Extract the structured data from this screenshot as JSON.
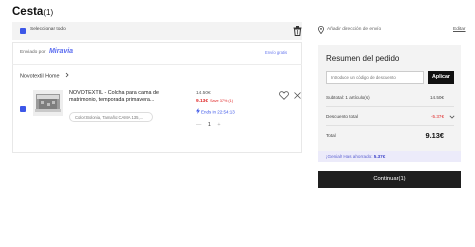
{
  "page": {
    "title": "Cesta",
    "title_count": "(1)"
  },
  "select_all": {
    "label": "Seleccionar todo"
  },
  "seller_block": {
    "sent_by": "Enviado por",
    "seller_name": "Miravia",
    "shipping": "Envío gratis",
    "store_name": "Novotextil Home"
  },
  "item": {
    "title": "NOVOTEXTIL - Colcha para cama de matrimonio, temporada primavera...",
    "variant": "Color:Bolonia, Tamaño:CAMA 135,...",
    "old_price": "14.50€",
    "new_price": "9.13€",
    "saving_tag": "Save 37% (1)",
    "ends_label": "Ends in 22:54:13",
    "quantity": "1",
    "qty_minus": "—",
    "qty_plus": "+"
  },
  "address": {
    "label": "Añadir dirección de envío",
    "edit": "Editar"
  },
  "summary": {
    "title": "Resumen del pedido",
    "coupon_placeholder": "Introduce un código de descuento",
    "apply": "Aplicar",
    "subtotal_label": "Subtotal: 1 artículo(s)",
    "subtotal_value": "14.50€",
    "discount_label": "Descuento total",
    "discount_value": "-5.37€",
    "total_label": "Total",
    "total_value": "9.13€",
    "savings_prefix": "¡Genial! Has ahorrado:",
    "savings_value": "5.37€",
    "checkout": "Continuar(1)"
  },
  "colors": {
    "accent_blue": "#3d57e8",
    "sale_red": "#e02828",
    "checkout_bg": "#1f1f1f",
    "panel_gray": "#f3f3f3"
  },
  "icons": [
    "checkbox-icon",
    "trash-icon",
    "chevron-right-icon",
    "heart-icon",
    "close-icon",
    "lightning-icon",
    "location-pin-icon",
    "chevron-down-icon"
  ]
}
